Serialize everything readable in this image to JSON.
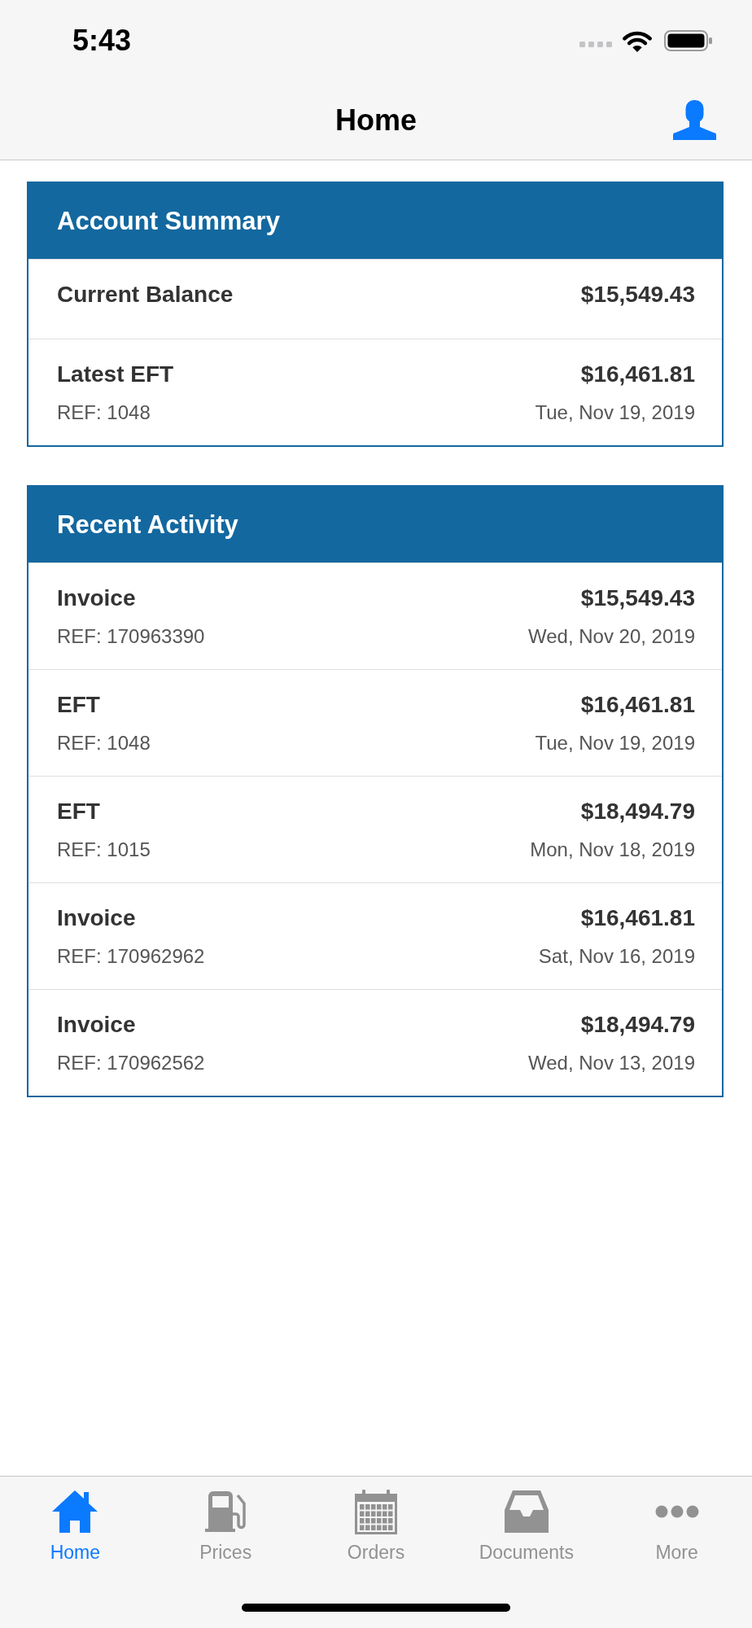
{
  "status_bar": {
    "time": "5:43"
  },
  "nav_bar": {
    "title": "Home"
  },
  "account_summary": {
    "title": "Account Summary",
    "rows": [
      {
        "label": "Current Balance",
        "amount": "$15,549.43"
      },
      {
        "label": "Latest EFT",
        "amount": "$16,461.81",
        "ref": "REF: 1048",
        "date": "Tue, Nov 19, 2019"
      }
    ]
  },
  "recent_activity": {
    "title": "Recent Activity",
    "rows": [
      {
        "label": "Invoice",
        "amount": "$15,549.43",
        "ref": "REF: 170963390",
        "date": "Wed, Nov 20, 2019"
      },
      {
        "label": "EFT",
        "amount": "$16,461.81",
        "ref": "REF: 1048",
        "date": "Tue, Nov 19, 2019"
      },
      {
        "label": "EFT",
        "amount": "$18,494.79",
        "ref": "REF: 1015",
        "date": "Mon, Nov 18, 2019"
      },
      {
        "label": "Invoice",
        "amount": "$16,461.81",
        "ref": "REF: 170962962",
        "date": "Sat, Nov 16, 2019"
      },
      {
        "label": "Invoice",
        "amount": "$18,494.79",
        "ref": "REF: 170962562",
        "date": "Wed, Nov 13, 2019"
      }
    ]
  },
  "tab_bar": {
    "tabs": [
      {
        "label": "Home",
        "selected": true
      },
      {
        "label": "Prices",
        "selected": false
      },
      {
        "label": "Orders",
        "selected": false
      },
      {
        "label": "Documents",
        "selected": false
      },
      {
        "label": "More",
        "selected": false
      }
    ]
  }
}
